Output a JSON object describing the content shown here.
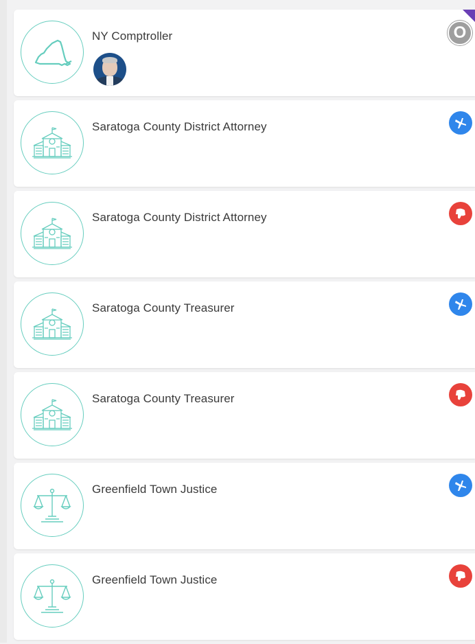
{
  "offices": [
    {
      "title": "NY Comptroller",
      "emblem": "ny-state-outline",
      "party": "other",
      "party_symbol": "O",
      "has_avatar": true
    },
    {
      "title": "Saratoga County District Attorney",
      "emblem": "county-building",
      "party": "democrat",
      "party_symbol": "donkey"
    },
    {
      "title": "Saratoga County District Attorney",
      "emblem": "county-building",
      "party": "republican",
      "party_symbol": "elephant"
    },
    {
      "title": "Saratoga County Treasurer",
      "emblem": "county-building",
      "party": "democrat",
      "party_symbol": "donkey"
    },
    {
      "title": "Saratoga County Treasurer",
      "emblem": "county-building",
      "party": "republican",
      "party_symbol": "elephant"
    },
    {
      "title": "Greenfield Town Justice",
      "emblem": "scales-of-justice",
      "party": "democrat",
      "party_symbol": "donkey"
    },
    {
      "title": "Greenfield Town Justice",
      "emblem": "scales-of-justice",
      "party": "republican",
      "party_symbol": "elephant"
    }
  ],
  "colors": {
    "emblem_stroke": "#65cdbe",
    "democrat": "#2f86eb",
    "republican": "#e8423b",
    "other": "#9e9e9e",
    "corner_flag": "#6a3fb5"
  }
}
